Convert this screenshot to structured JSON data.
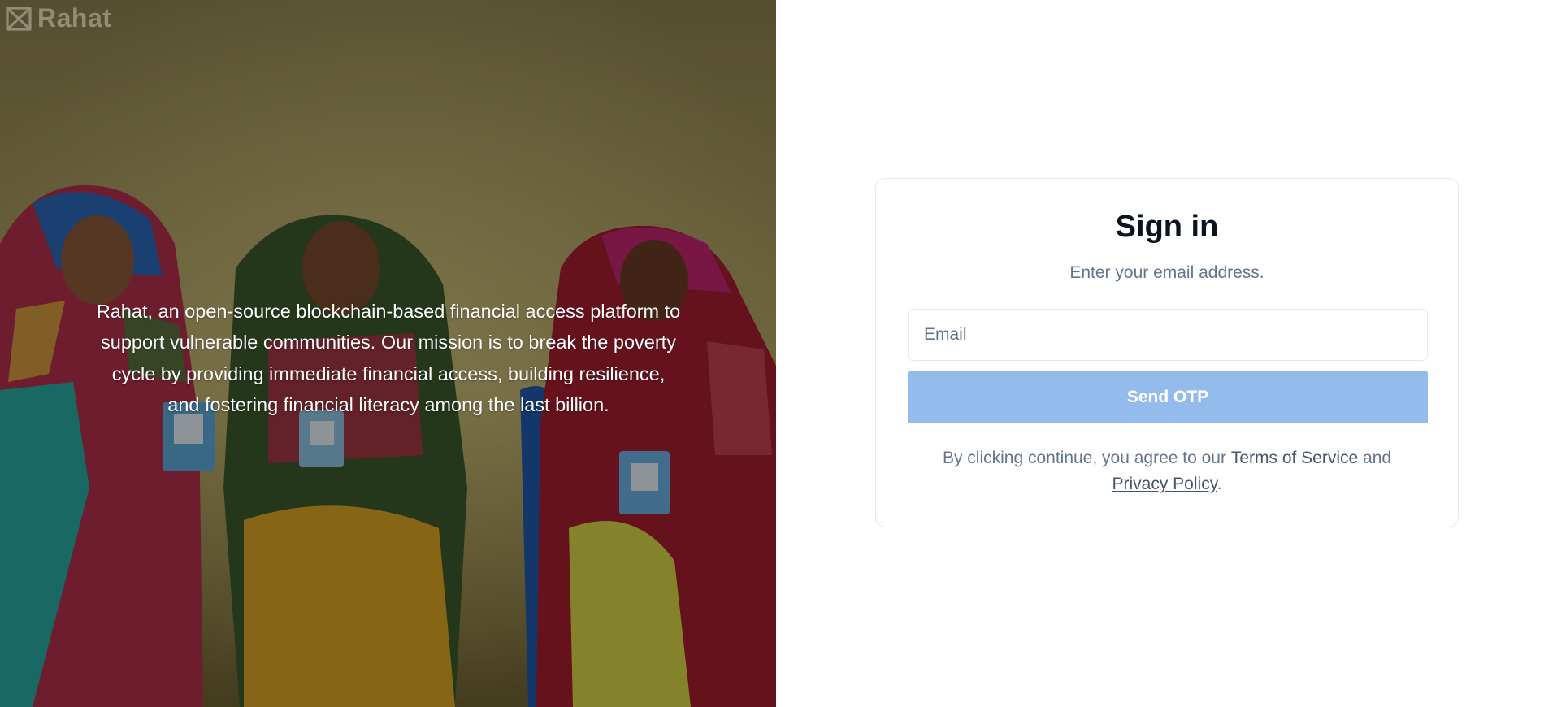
{
  "brand": {
    "name": "Rahat",
    "logo_icon": "rahat-bowtie-logo-icon"
  },
  "hero": {
    "mission_text": "Rahat, an open-source blockchain-based financial access platform to support vulnerable communities. Our mission is to break the poverty cycle by providing immediate financial access, building resilience, and fostering financial literacy among the last billion.",
    "photo_icon": "community-women-photo"
  },
  "signin": {
    "title": "Sign in",
    "subtitle": "Enter your email address.",
    "email_placeholder": "Email",
    "email_value": "",
    "send_label": "Send OTP",
    "terms_prefix": "By clicking continue, you agree to our ",
    "terms_link": "Terms of Service",
    "terms_and": " and",
    "privacy_link": "Privacy Policy",
    "terms_suffix": "."
  },
  "colors": {
    "primary_button": "#93bbeb",
    "text_muted": "#64748b",
    "heading": "#0b1220",
    "card_border": "#e5e7eb"
  }
}
